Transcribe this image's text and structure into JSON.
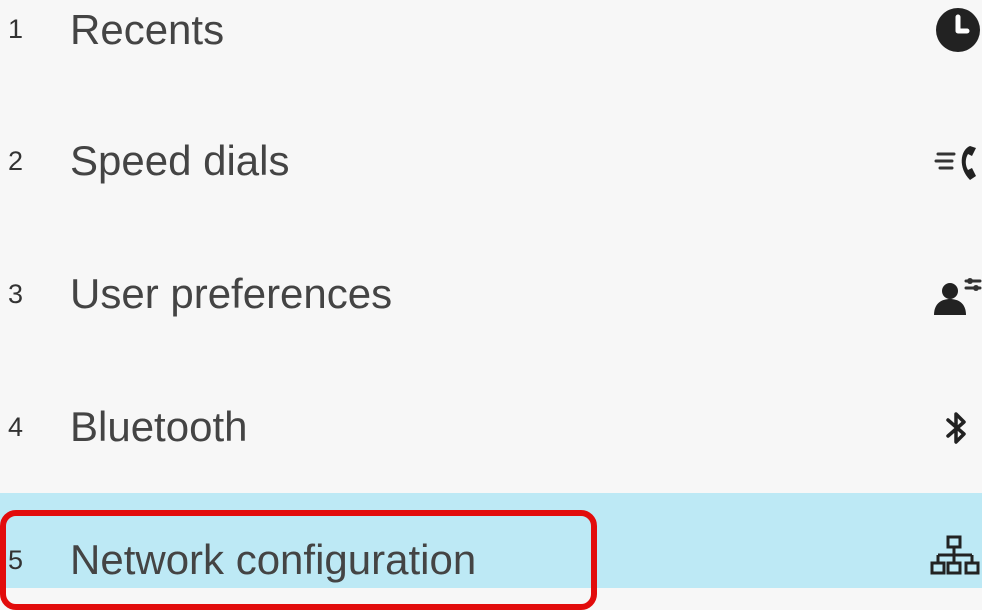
{
  "menu": {
    "items": [
      {
        "number": "1",
        "label": "Recents",
        "icon": "recents-clock-icon"
      },
      {
        "number": "2",
        "label": "Speed dials",
        "icon": "speed-dial-icon"
      },
      {
        "number": "3",
        "label": "User preferences",
        "icon": "user-preferences-icon"
      },
      {
        "number": "4",
        "label": "Bluetooth",
        "icon": "bluetooth-icon"
      },
      {
        "number": "5",
        "label": "Network configuration",
        "icon": "network-icon",
        "selected": true
      }
    ]
  },
  "colors": {
    "background": "#f7f7f7",
    "selected_row": "#bde9f5",
    "highlight_border": "#e20c0c",
    "text": "#444444"
  }
}
